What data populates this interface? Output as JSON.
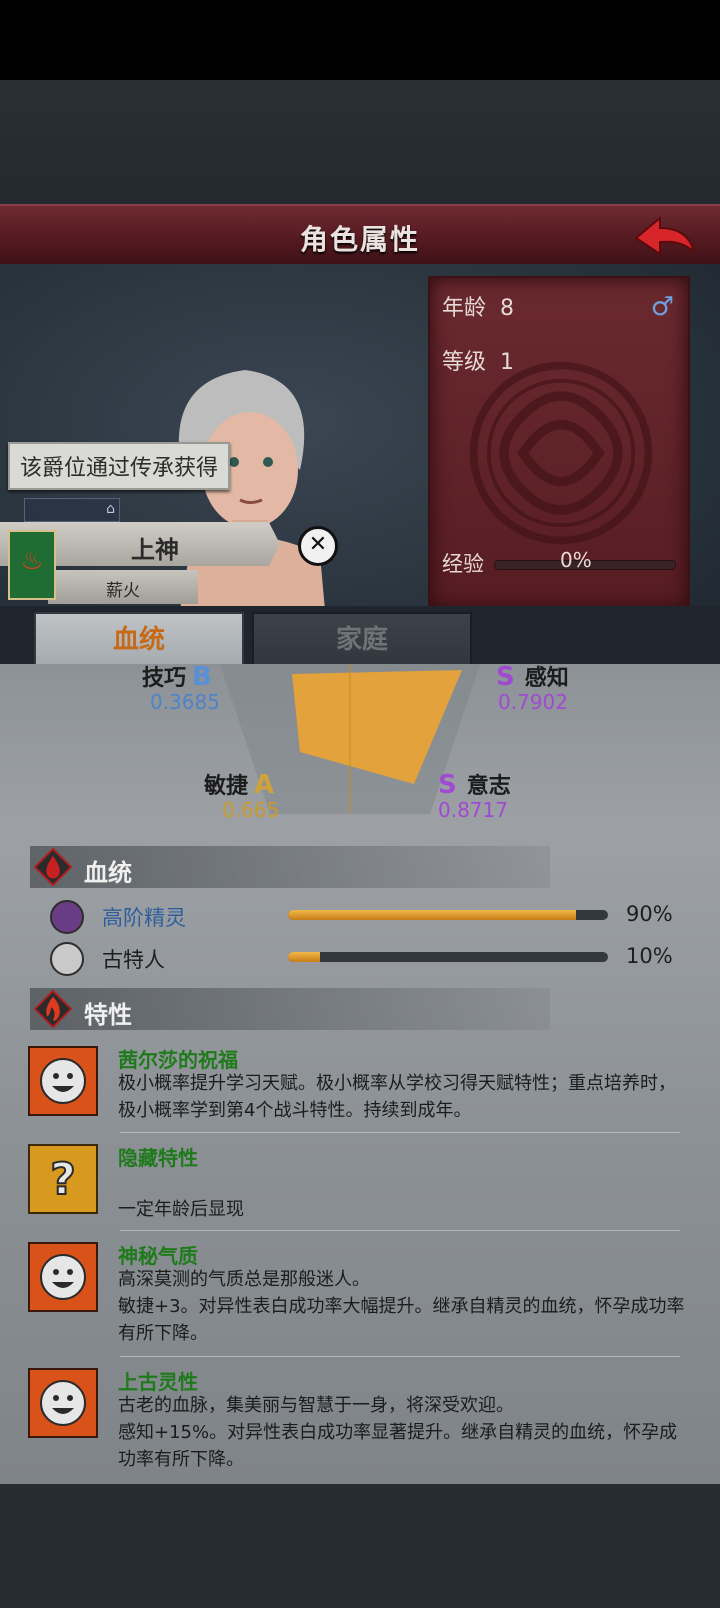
{
  "header": {
    "title": "角色属性"
  },
  "stats": {
    "age_label": "年龄",
    "age_value": "8",
    "level_label": "等级",
    "level_value": "1",
    "gender_symbol": "♂",
    "exp_label": "经验",
    "exp_value": "0%",
    "exp_fraction": 0
  },
  "tooltip": "该爵位通过传承获得",
  "title_banner": {
    "rank": "上神",
    "sub": "薪火"
  },
  "tabs": [
    {
      "label": "血统",
      "active": true
    },
    {
      "label": "家庭",
      "active": false
    }
  ],
  "attributes": {
    "skill": {
      "label": "技巧",
      "grade": "B",
      "value": "0.3685"
    },
    "perception": {
      "label": "感知",
      "grade": "S",
      "value": "0.7902"
    },
    "agility": {
      "label": "敏捷",
      "grade": "A",
      "value": "0.665"
    },
    "will": {
      "label": "意志",
      "grade": "S",
      "value": "0.8717"
    }
  },
  "bloodline": {
    "title": "血统",
    "items": [
      {
        "name": "高阶精灵",
        "pct": "90%",
        "fraction": 0.9
      },
      {
        "name": "古特人",
        "pct": "10%",
        "fraction": 0.1
      }
    ]
  },
  "traits": {
    "title": "特性",
    "items": [
      {
        "name": "茜尔莎的祝福",
        "desc": "极小概率提升学习天赋。极小概率从学校习得天赋特性；重点培养时，极小概率学到第4个战斗特性。持续到成年。",
        "icon": "smiley-icon"
      },
      {
        "name": "隐藏特性",
        "desc": "一定年龄后显现",
        "icon": "question-icon"
      },
      {
        "name": "神秘气质",
        "desc": "高深莫测的气质总是那般迷人。\n敏捷+3。对异性表白成功率大幅提升。继承自精灵的血统，怀孕成功率有所下降。",
        "icon": "smiley-icon"
      },
      {
        "name": "上古灵性",
        "desc": "古老的血脉，集美丽与智慧于一身，将深受欢迎。\n感知+15%。对异性表白成功率显著提升。继承自精灵的血统，怀孕成功率有所下降。",
        "icon": "smiley-icon"
      }
    ]
  },
  "colors": {
    "header_red": "#5a1c22",
    "accent_orange": "#e3a23b",
    "grade_blue": "#5a8fd8",
    "grade_purple": "#a04ad2",
    "grade_gold": "#d0a23a",
    "trait_green": "#1f7a1b"
  }
}
